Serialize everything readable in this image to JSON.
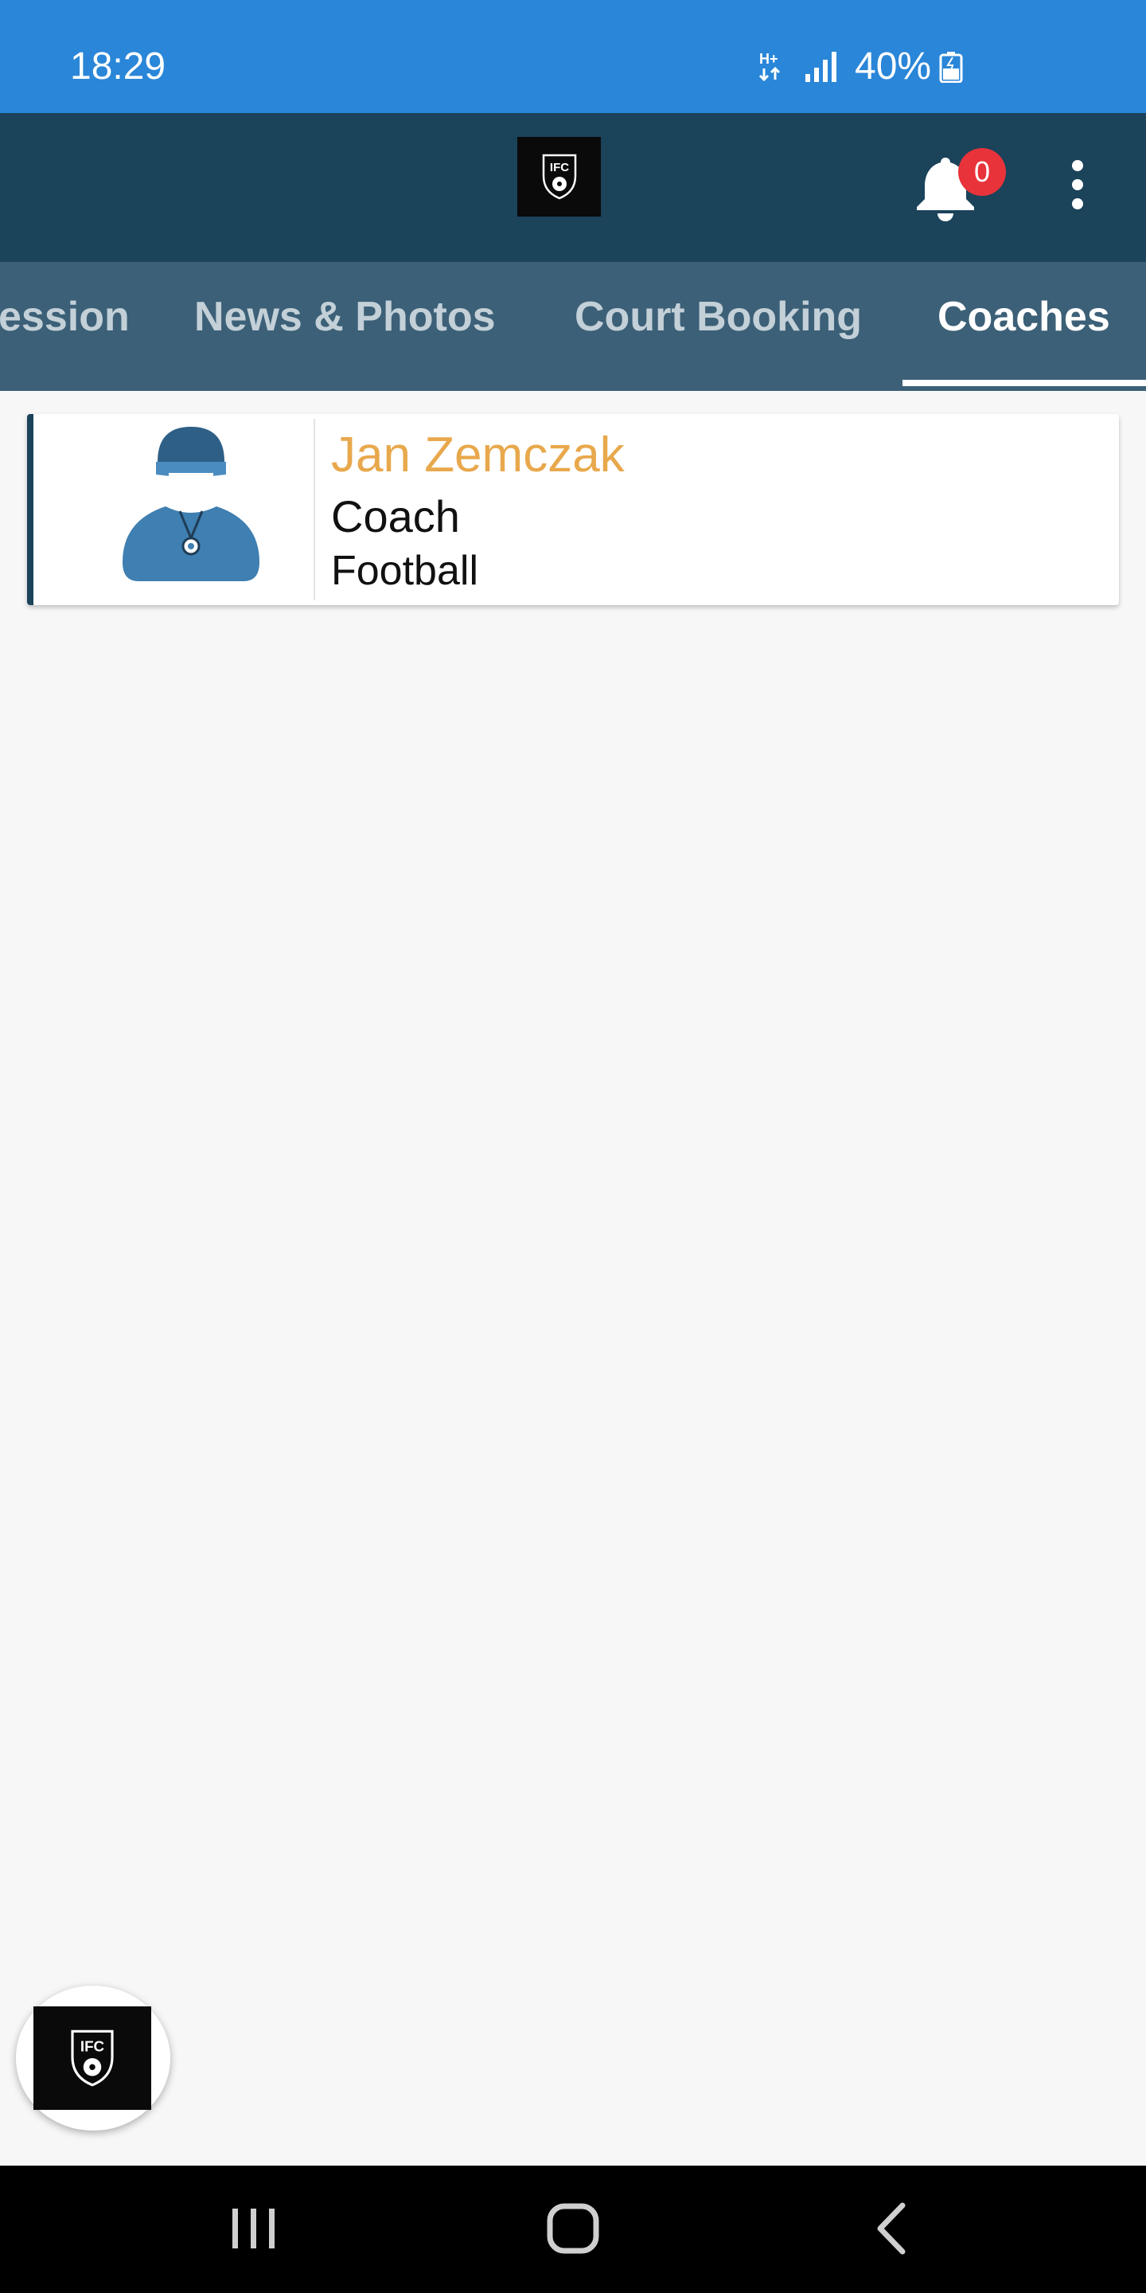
{
  "status_bar": {
    "time": "18:29",
    "network": "H+",
    "battery_percent": "40%"
  },
  "header": {
    "logo_text": "IFC",
    "notification_count": "0",
    "icons": [
      "bell-icon",
      "more-vert-icon"
    ]
  },
  "tabs": [
    {
      "label": "ession",
      "active": false
    },
    {
      "label": "News & Photos",
      "active": false
    },
    {
      "label": "Court Booking",
      "active": false
    },
    {
      "label": "Coaches",
      "active": true
    }
  ],
  "coaches": [
    {
      "name": "Jan Zemczak",
      "role": "Coach",
      "sport": "Football",
      "avatar_icon": "coach-avatar-icon"
    }
  ],
  "fab": {
    "logo_text": "IFC"
  },
  "colors": {
    "status_bar": "#2a86d8",
    "header": "#1b435a",
    "tab_bar": "#3c6077",
    "coach_name": "#e8a84c",
    "badge": "#e8333a",
    "background": "#f7f7f7"
  },
  "nav_bar": {
    "icons": [
      "recents-icon",
      "home-icon",
      "back-icon"
    ]
  }
}
